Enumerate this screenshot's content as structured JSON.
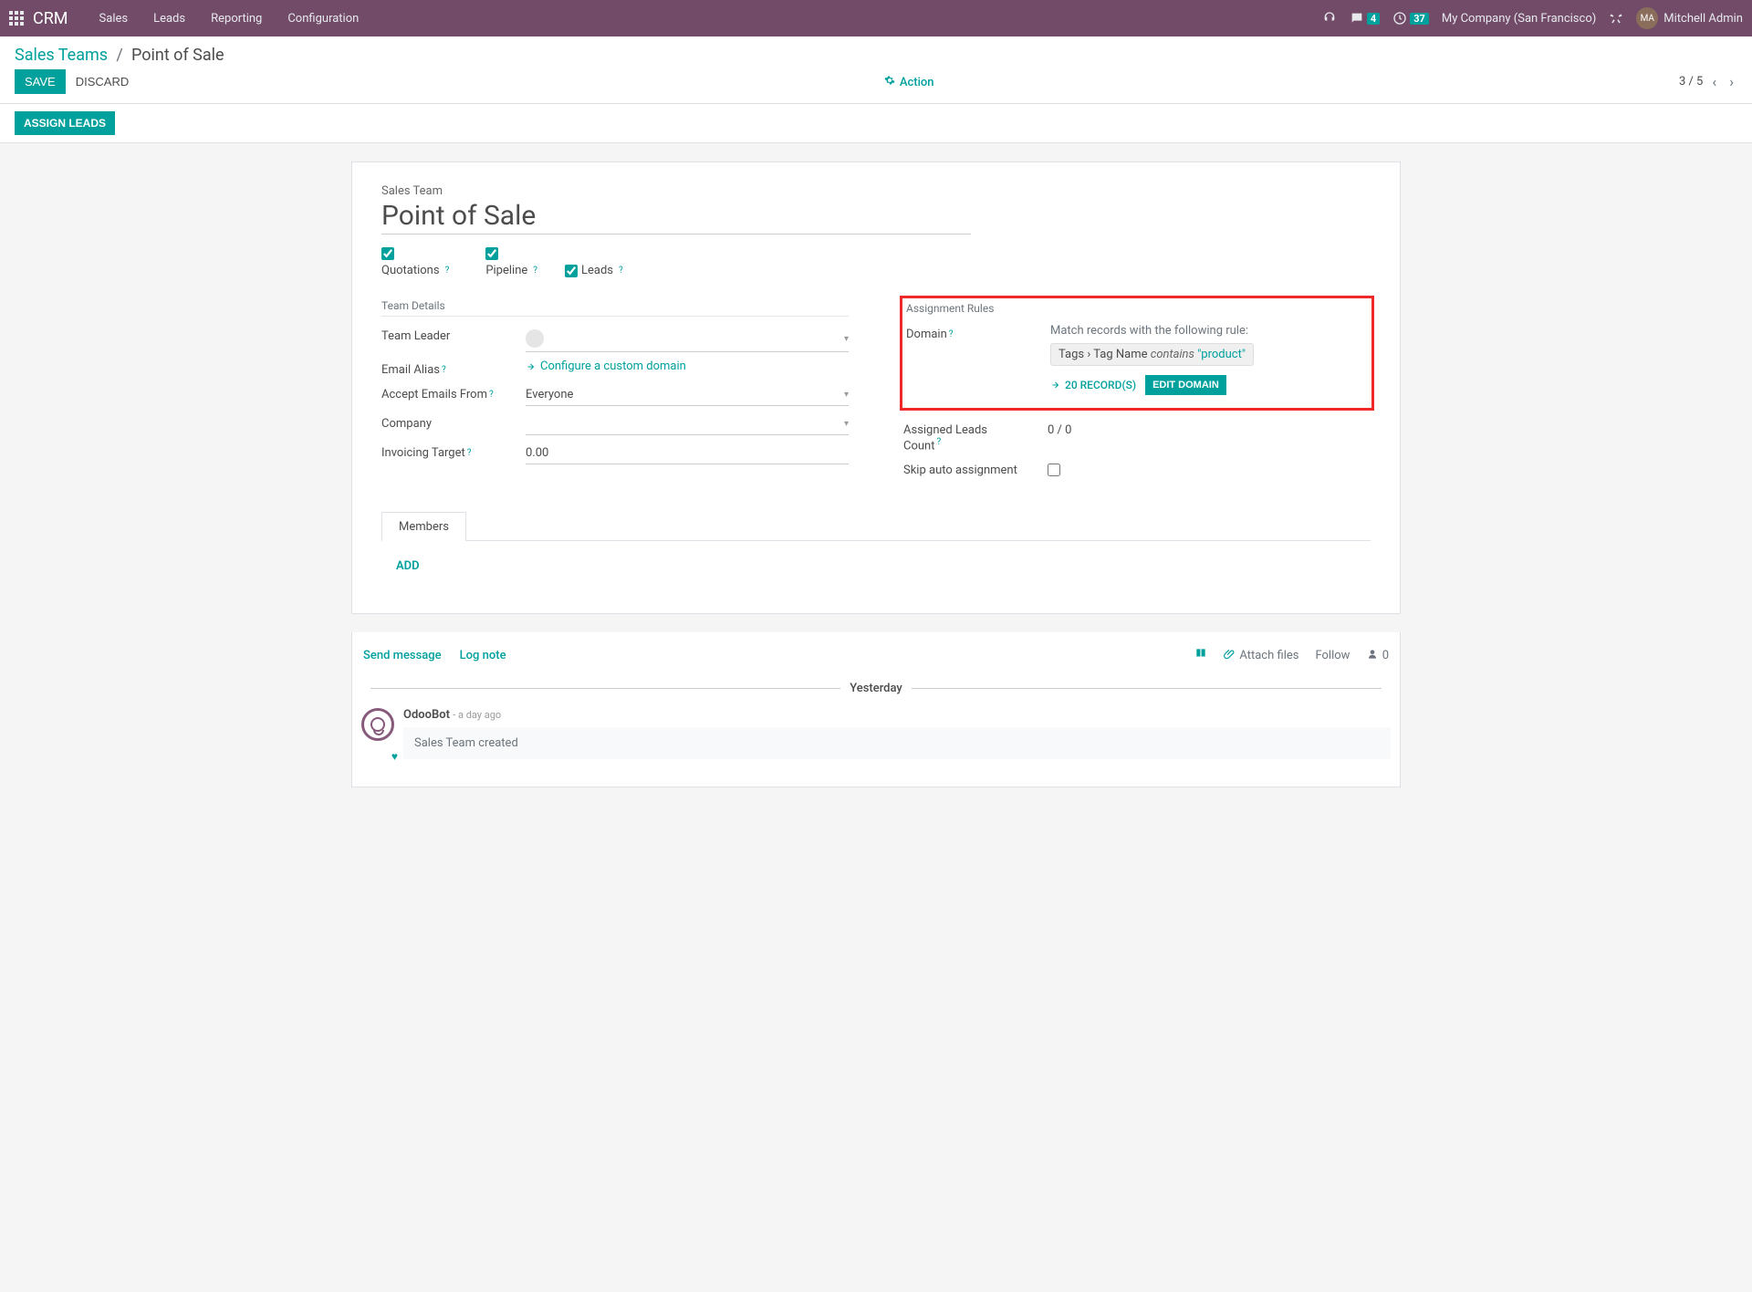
{
  "navbar": {
    "brand": "CRM",
    "menu": [
      "Sales",
      "Leads",
      "Reporting",
      "Configuration"
    ],
    "msg_badge": "4",
    "clock_badge": "37",
    "company": "My Company (San Francisco)",
    "user": "Mitchell Admin"
  },
  "breadcrumb": {
    "parent": "Sales Teams",
    "current": "Point of Sale"
  },
  "buttons": {
    "save": "Save",
    "discard": "Discard",
    "action": "Action",
    "assign_leads": "Assign Leads"
  },
  "pager": {
    "text": "3 / 5"
  },
  "form": {
    "title_label": "Sales Team",
    "title_value": "Point of Sale",
    "quotations_label": "Quotations",
    "pipeline_label": "Pipeline",
    "leads_label": "Leads",
    "team_details_title": "Team Details",
    "team_leader_label": "Team Leader",
    "email_alias_label": "Email Alias",
    "config_domain_link": "Configure a custom domain",
    "accept_emails_label": "Accept Emails From",
    "accept_emails_value": "Everyone",
    "company_label": "Company",
    "invoicing_target_label": "Invoicing Target",
    "invoicing_target_value": "0.00",
    "assignment_rules_title": "Assignment Rules",
    "domain_label": "Domain",
    "domain_match_text": "Match records with the following rule:",
    "domain_path": "Tags › Tag Name",
    "domain_op": "contains",
    "domain_val": "\"product\"",
    "records_link": "20 RECORD(S)",
    "edit_domain_btn": "EDIT DOMAIN",
    "assigned_leads_label_l1": "Assigned Leads",
    "assigned_leads_label_l2": "Count",
    "assigned_leads_value": "0 / 0",
    "skip_auto_label": "Skip auto assignment"
  },
  "tabs": {
    "members": "Members",
    "add": "ADD"
  },
  "chatter": {
    "send_message": "Send message",
    "log_note": "Log note",
    "attach": "Attach files",
    "follow": "Follow",
    "followers": "0",
    "date": "Yesterday",
    "author": "OdooBot",
    "time": "- a day ago",
    "content": "Sales Team created"
  }
}
